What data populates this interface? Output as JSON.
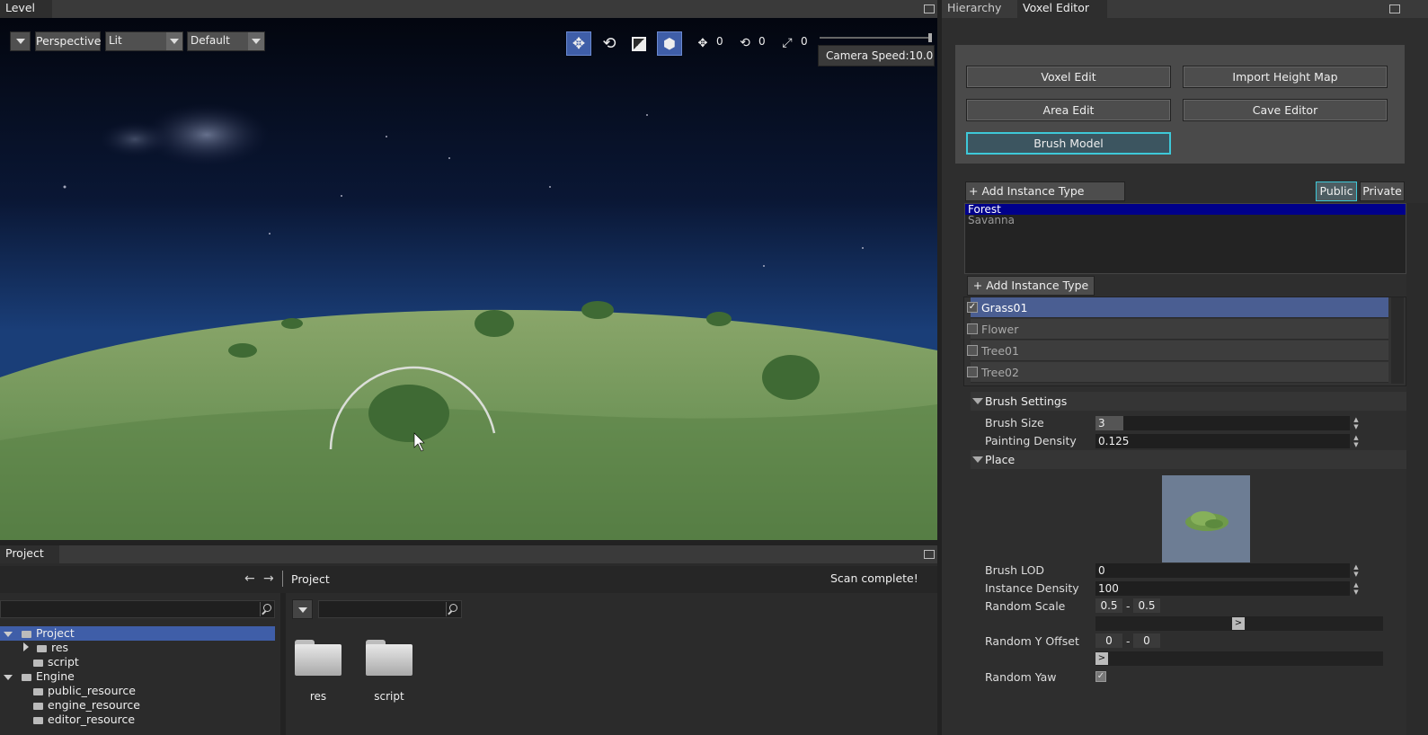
{
  "level_panel": {
    "tab": "Level",
    "toolbar": {
      "view_mode": "Perspective",
      "shading": "Lit",
      "layout": "Default",
      "move_snap": "0",
      "rotate_snap": "0",
      "scale_snap": "0",
      "camera_speed": "Camera Speed:10.0"
    }
  },
  "right_panel": {
    "tabs": [
      "Hierarchy",
      "Voxel Editor"
    ],
    "voxel_buttons": {
      "voxel_edit": "Voxel Edit",
      "import_height_map": "Import Height Map",
      "area_edit": "Area Edit",
      "cave_editor": "Cave Editor",
      "brush_model": "Brush Model"
    },
    "packages": {
      "add_label": "+ Add Instance Type Package",
      "public_label": "Public",
      "private_label": "Private",
      "items": [
        "Forest",
        "Savanna"
      ],
      "selected": "Forest"
    },
    "instance_types": {
      "add_label": "+ Add Instance Type",
      "items": [
        {
          "name": "Grass01",
          "checked": true
        },
        {
          "name": "Flower",
          "checked": false
        },
        {
          "name": "Tree01",
          "checked": false
        },
        {
          "name": "Tree02",
          "checked": false
        }
      ]
    },
    "brush_settings": {
      "title": "Brush Settings",
      "brush_size_label": "Brush Size",
      "brush_size": "3",
      "brush_size_fraction": 0.11,
      "painting_density_label": "Painting Density",
      "painting_density": "0.125"
    },
    "place": {
      "title": "Place",
      "brush_lod_label": "Brush LOD",
      "brush_lod": "0",
      "instance_density_label": "Instance Density",
      "instance_density": "100",
      "random_scale_label": "Random Scale",
      "random_scale_min": "0.5",
      "random_scale_max": "0.5",
      "random_y_offset_label": "Random Y Offset",
      "random_y_min": "0",
      "random_y_max": "0",
      "random_yaw_label": "Random Yaw",
      "range_separator": "-",
      "slider_handle": ">"
    }
  },
  "project_panel": {
    "tab": "Project",
    "breadcrumb": "Project",
    "status": "Scan complete!",
    "tree": [
      {
        "label": "Project",
        "level": 0,
        "expanded": true
      },
      {
        "label": "res",
        "level": 1,
        "collapsed": true
      },
      {
        "label": "script",
        "level": 1
      },
      {
        "label": "Engine",
        "level": 0,
        "expanded": true
      },
      {
        "label": "public_resource",
        "level": 1
      },
      {
        "label": "engine_resource",
        "level": 1
      },
      {
        "label": "editor_resource",
        "level": 1
      }
    ],
    "files": [
      "res",
      "script"
    ]
  },
  "colors": {
    "accent_blue": "#3f5ea8",
    "selection_navy": "#00008b",
    "brush_model_border": "#3ec8d8"
  }
}
